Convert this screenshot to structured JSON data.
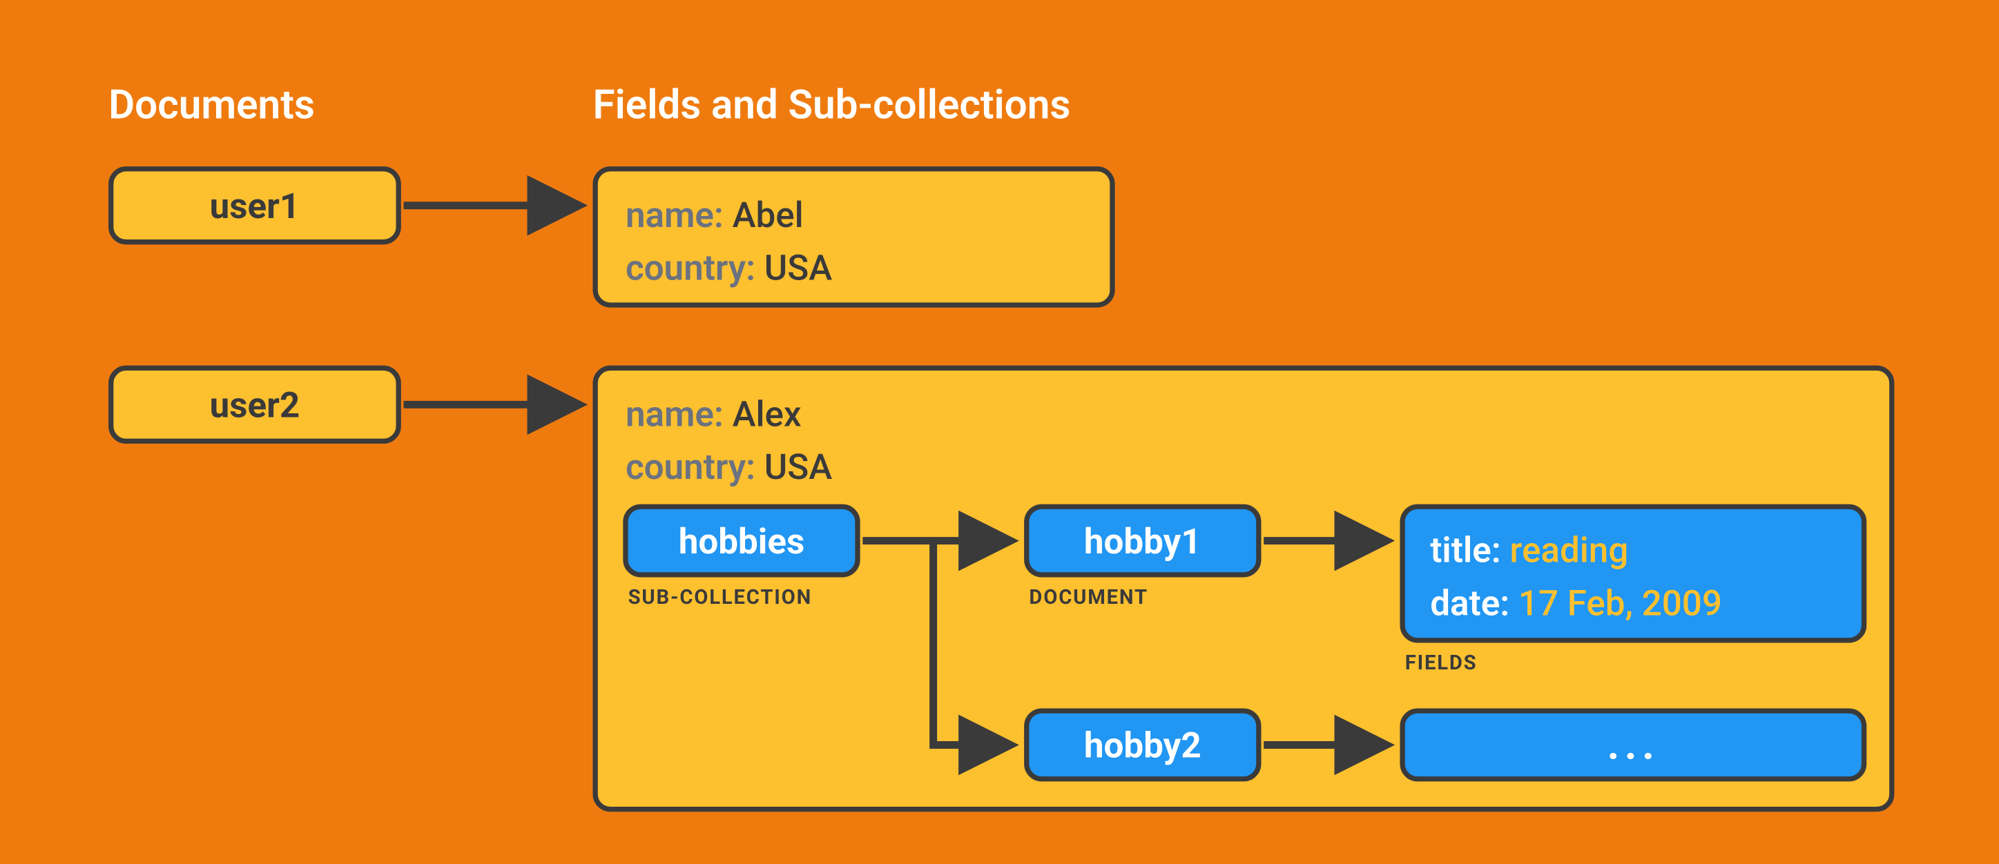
{
  "headings": {
    "documents": "Documents",
    "fields": "Fields and Sub-collections"
  },
  "docs": {
    "user1": "user1",
    "user2": "user2"
  },
  "user1_fields": {
    "name_key": "name:",
    "name_val": "Abel",
    "country_key": "country:",
    "country_val": "USA"
  },
  "user2_fields": {
    "name_key": "name:",
    "name_val": "Alex",
    "country_key": "country:",
    "country_val": "USA"
  },
  "sub": {
    "hobbies": "hobbies",
    "hobby1": "hobby1",
    "hobby2": "hobby2",
    "ellipsis": "..."
  },
  "captions": {
    "subcollection": "SUB-COLLECTION",
    "document": "DOCUMENT",
    "fields": "FIELDS"
  },
  "hobby1_fields": {
    "title_key": "title:",
    "title_val": "reading",
    "date_key": "date:",
    "date_val": "17 Feb, 2009"
  }
}
